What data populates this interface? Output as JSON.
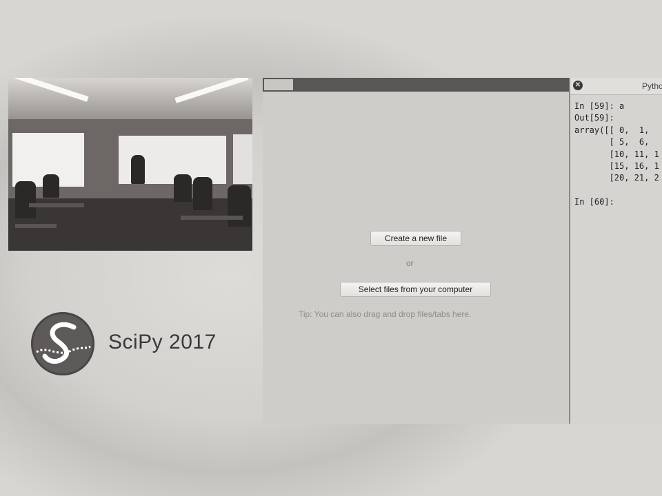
{
  "console": {
    "title": "Pytho",
    "close_glyph": "✕",
    "lines": [
      "In [59]: a",
      "Out[59]:",
      "array([[ 0,  1,",
      "       [ 5,  6,",
      "       [10, 11, 1",
      "       [15, 16, 1",
      "       [20, 21, 2",
      "",
      "In [60]:"
    ]
  },
  "file_panel": {
    "create_label": "Create a new file",
    "or_label": "or",
    "select_label": "Select files from your computer",
    "tip": "Tip: You can also drag and drop files/tabs here."
  },
  "branding": {
    "conference": "SciPy 2017"
  },
  "colors": {
    "panel_bar": "#5b5656",
    "panel_bg": "#cfcdca",
    "console_bg": "#d6d4d1"
  }
}
